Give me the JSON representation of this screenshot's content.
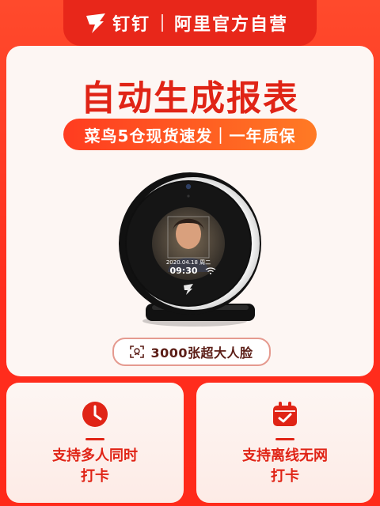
{
  "header": {
    "brand_name": "钉钉",
    "subtitle": "阿里官方自营",
    "logo_icon": "dingtalk-wing-icon"
  },
  "promo": {
    "title": "自动生成报表",
    "subtitle": "菜鸟5仓现货速发｜一年质保"
  },
  "device": {
    "screen_date": "2020.04.18 周二",
    "screen_time": "09:30"
  },
  "badge": {
    "text": "3000张超大人脸",
    "icon": "face-scan-icon"
  },
  "features": [
    {
      "icon": "clock-icon",
      "line1": "支持多人同时",
      "line2": "打卡"
    },
    {
      "icon": "calendar-icon",
      "line1": "支持离线无网",
      "line2": "打卡"
    }
  ],
  "colors": {
    "primary_red": "#e02416",
    "bg_red": "#ff3a22",
    "card_bg": "#fdf6f3",
    "pill_gradient_start": "#ff3c20",
    "pill_gradient_end": "#ff7a24"
  }
}
